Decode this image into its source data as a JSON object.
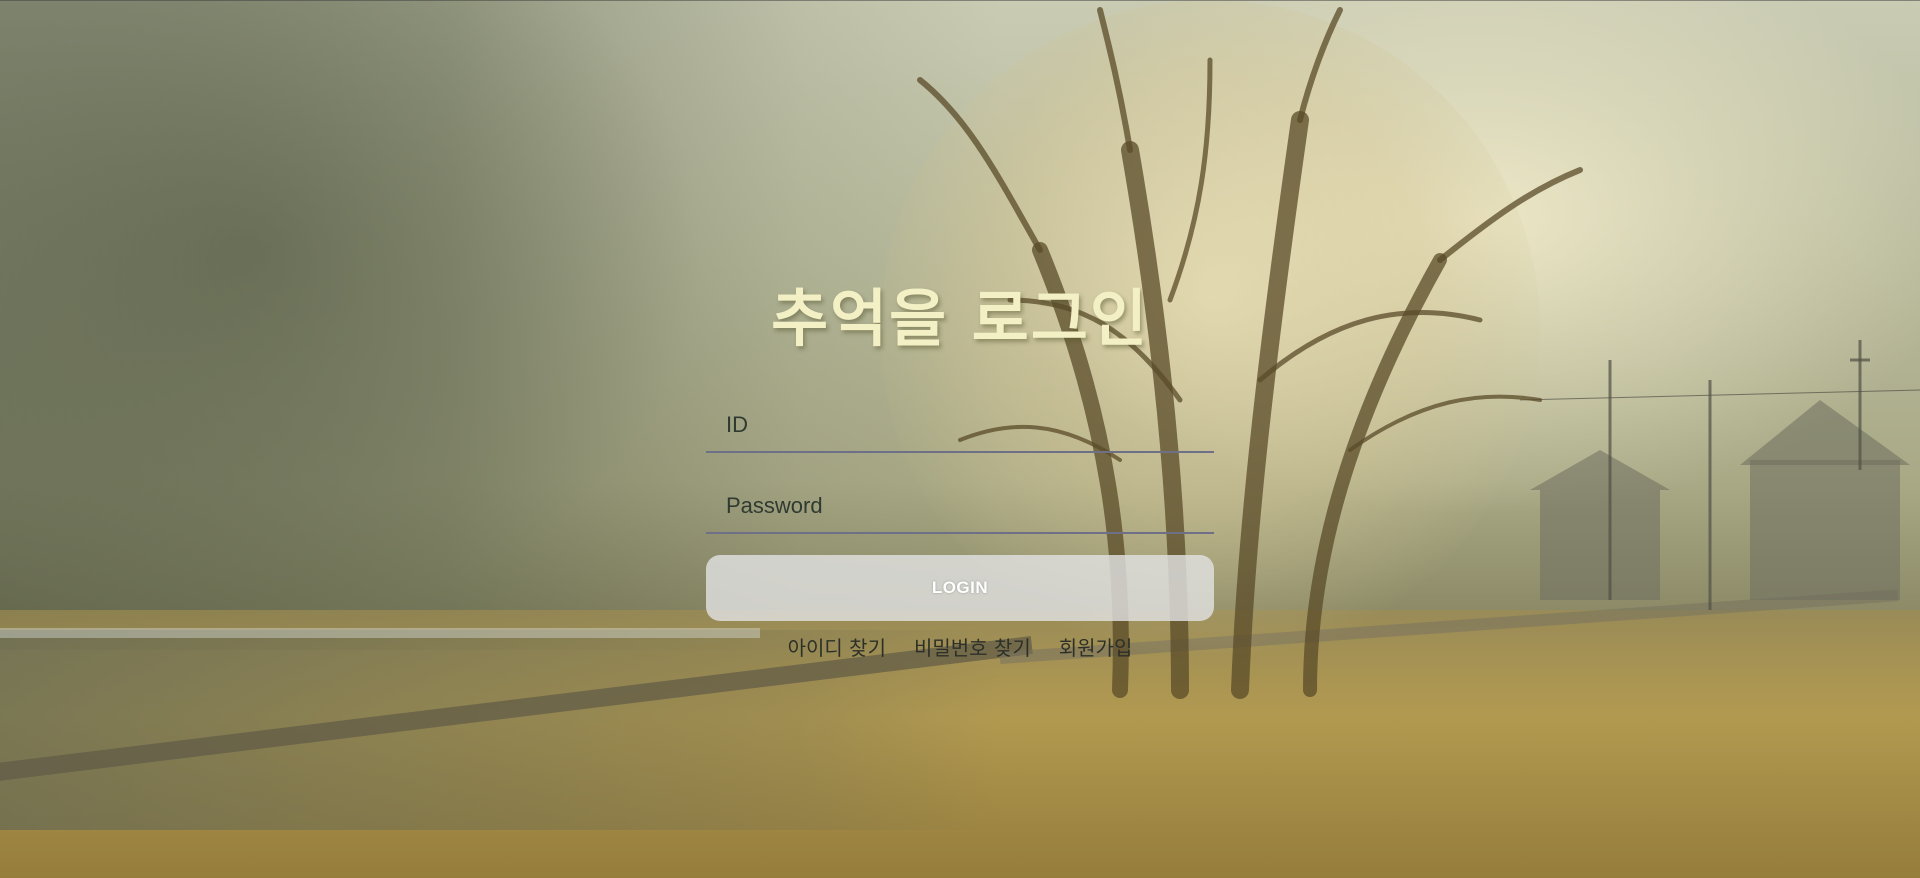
{
  "page": {
    "title": "추억을 로그인"
  },
  "form": {
    "id_placeholder": "ID",
    "id_value": "",
    "password_placeholder": "Password",
    "password_value": "",
    "login_label": "LOGIN"
  },
  "links": {
    "find_id": "아이디 찾기",
    "find_password": "비밀번호 찾기",
    "sign_up": "회원가입"
  },
  "colors": {
    "title": "#f2f0c4",
    "underline": "#6e7088",
    "button_bg": "rgba(225,225,225,0.82)",
    "link_text": "#2d3028"
  },
  "background": {
    "description_icon": "foggy-tree-field-image"
  }
}
